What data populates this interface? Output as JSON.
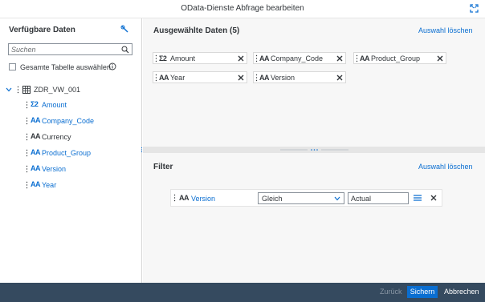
{
  "dialog": {
    "title": "OData-Dienste Abfrage bearbeiten",
    "expand_icon": "fullscreen-icon"
  },
  "left_panel": {
    "header": "Verfügbare Daten",
    "search_placeholder": "Suchen",
    "select_all_label": "Gesamte Tabelle auswählen",
    "select_all_checked": false,
    "tree": {
      "root_label": "ZDR_VW_001",
      "expanded": true,
      "items": [
        {
          "type": "Σ2",
          "label": "Amount",
          "state": "selected"
        },
        {
          "type": "AA",
          "label": "Company_Code",
          "state": "selected"
        },
        {
          "type": "AA",
          "label": "Currency",
          "state": "unselected"
        },
        {
          "type": "AA",
          "label": "Product_Group",
          "state": "selected"
        },
        {
          "type": "AA",
          "label": "Version",
          "state": "selected"
        },
        {
          "type": "AA",
          "label": "Year",
          "state": "selected"
        }
      ]
    }
  },
  "selected_panel": {
    "header": "Ausgewählte Daten (5)",
    "clear_link": "Auswahl löschen",
    "tokens": [
      {
        "type": "Σ2",
        "label": "Amount"
      },
      {
        "type": "AA",
        "label": "Company_Code"
      },
      {
        "type": "AA",
        "label": "Product_Group"
      },
      {
        "type": "AA",
        "label": "Year"
      },
      {
        "type": "AA",
        "label": "Version"
      }
    ]
  },
  "filter_panel": {
    "header": "Filter",
    "clear_link": "Auswahl löschen",
    "row": {
      "type": "AA",
      "field": "Version",
      "operator": "Gleich",
      "value": "Actual"
    }
  },
  "footer": {
    "back_label": "Zurück",
    "save_label": "Sichern",
    "cancel_label": "Abbrechen"
  },
  "colors": {
    "accent": "#0a6ed1",
    "footer_bg": "#354a5f",
    "panel_bg": "#f7f7f7",
    "text": "#32363a"
  }
}
